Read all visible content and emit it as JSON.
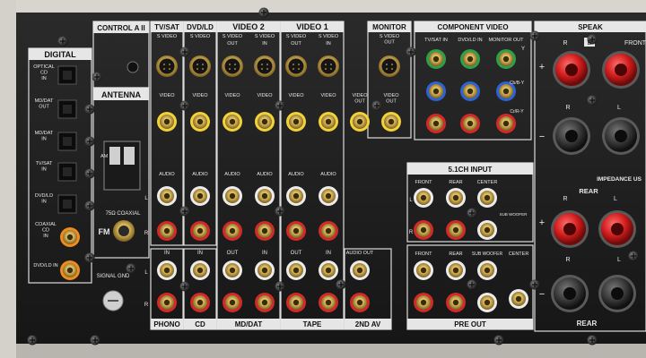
{
  "panel": {
    "header_labels": {
      "digital": "DIGITAL",
      "control": "CONTROL A II",
      "antenna": "ANTENNA",
      "tv_sat": "TV/SAT",
      "dvd_ld": "DVD/LD",
      "video2": "VIDEO 2",
      "video1": "VIDEO 1",
      "monitor": "MONITOR",
      "component": "COMPONENT VIDEO",
      "speakers": "SPEAK",
      "input51": "5.1CH INPUT",
      "impedance": "IMPEDANCE US",
      "rear": "REAR"
    },
    "bottom_labels": {
      "phono": "PHONO",
      "cd": "CD",
      "mddat": "MD/DAT",
      "tape": "TAPE",
      "av2": "2ND AV",
      "preout": "PRE OUT",
      "rear2": "REAR"
    },
    "digital_labels": {
      "optical_cd": "OPTICAL\nCD\nIN",
      "md_dat_out": "MD/DAT\nOUT",
      "md_dat_in": "MD/DAT\nIN",
      "tvsat_in": "TV/SAT\nIN",
      "dvdld_in": "DVD/LD\nIN",
      "coaxial_cd": "COAXIAL\nCD\nIN",
      "dvdld_in2": "DVD/LD IN"
    },
    "misc_labels": {
      "fm": "FM",
      "coaxial75": "75Ω COAXIAL",
      "signal_gnd": "SIGNAL GND",
      "s_video": "S VIDEO",
      "s_video_out": "S VIDEO\nOUT",
      "video": "VIDEO",
      "video_out": "VIDEO\nOUT",
      "audio_out": "AUDIO OUT",
      "in": "IN",
      "out": "OUT",
      "audio": "AUDIO",
      "front": "FRONT",
      "rear_lbl": "REAR",
      "center": "CENTER",
      "sub_woofer": "SUB WOOFER",
      "tvsat_in": "TV/SAT IN",
      "dvdld_in": "DVD/LD IN",
      "monitor_out": "MONITOR OUT",
      "y": "Y",
      "cb": "Cb/B-Y",
      "cr": "Cr/R-Y",
      "front_spk": "FRONT",
      "L": "L",
      "R": "R",
      "plus": "+",
      "minus": "−",
      "B": "B",
      "am": "AM"
    }
  }
}
